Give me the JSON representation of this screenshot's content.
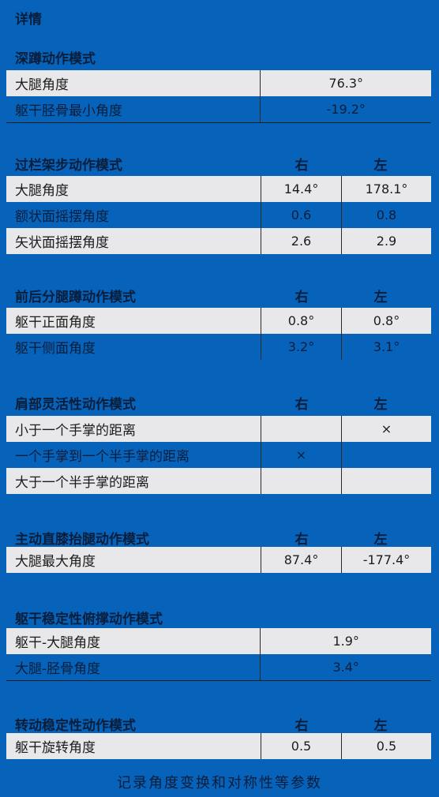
{
  "title": "详情",
  "sections": [
    {
      "title": "深蹲动作模式",
      "rows": [
        {
          "label": "大腿角度",
          "value": "76.3°"
        },
        {
          "label": "躯干胫骨最小角度",
          "value": "-19.2°"
        }
      ]
    },
    {
      "title": "过栏架步动作模式",
      "col_right": "右",
      "col_left": "左",
      "rows": [
        {
          "label": "大腿角度",
          "right": "14.4°",
          "left": "178.1°"
        },
        {
          "label": "额状面摇摆角度",
          "right": "0.6",
          "left": "0.8"
        },
        {
          "label": "矢状面摇摆角度",
          "right": "2.6",
          "left": "2.9"
        }
      ]
    },
    {
      "title": "前后分腿蹲动作模式",
      "col_right": "右",
      "col_left": "左",
      "rows": [
        {
          "label": "躯干正面角度",
          "right": "0.8°",
          "left": "0.8°"
        },
        {
          "label": "躯干侧面角度",
          "right": "3.2°",
          "left": "3.1°"
        }
      ]
    },
    {
      "title": "肩部灵活性动作模式",
      "col_right": "右",
      "col_left": "左",
      "rows": [
        {
          "label": "小于一个手掌的距离",
          "right": "",
          "left": "×"
        },
        {
          "label": "一个手掌到一个半手掌的距离",
          "right": "×",
          "left": ""
        },
        {
          "label": "大于一个半手掌的距离",
          "right": "",
          "left": ""
        }
      ]
    },
    {
      "title": "主动直膝抬腿动作模式",
      "col_right": "右",
      "col_left": "左",
      "rows": [
        {
          "label": "大腿最大角度",
          "right": "87.4°",
          "left": "-177.4°"
        }
      ]
    },
    {
      "title": "躯干稳定性俯撑动作模式",
      "rows": [
        {
          "label": "躯干-大腿角度",
          "value": "1.9°"
        },
        {
          "label": "大腿-胫骨角度",
          "value": "3.4°"
        }
      ]
    },
    {
      "title": "转动稳定性动作模式",
      "col_right": "右",
      "col_left": "左",
      "rows": [
        {
          "label": "躯干旋转角度",
          "right": "0.5",
          "left": "0.5"
        }
      ]
    }
  ],
  "caption": "记录角度变换和对称性等参数",
  "colors": {
    "background": "#0663b9",
    "row_light": "#e8e8ea",
    "text_dark": "#0a1e3c"
  }
}
